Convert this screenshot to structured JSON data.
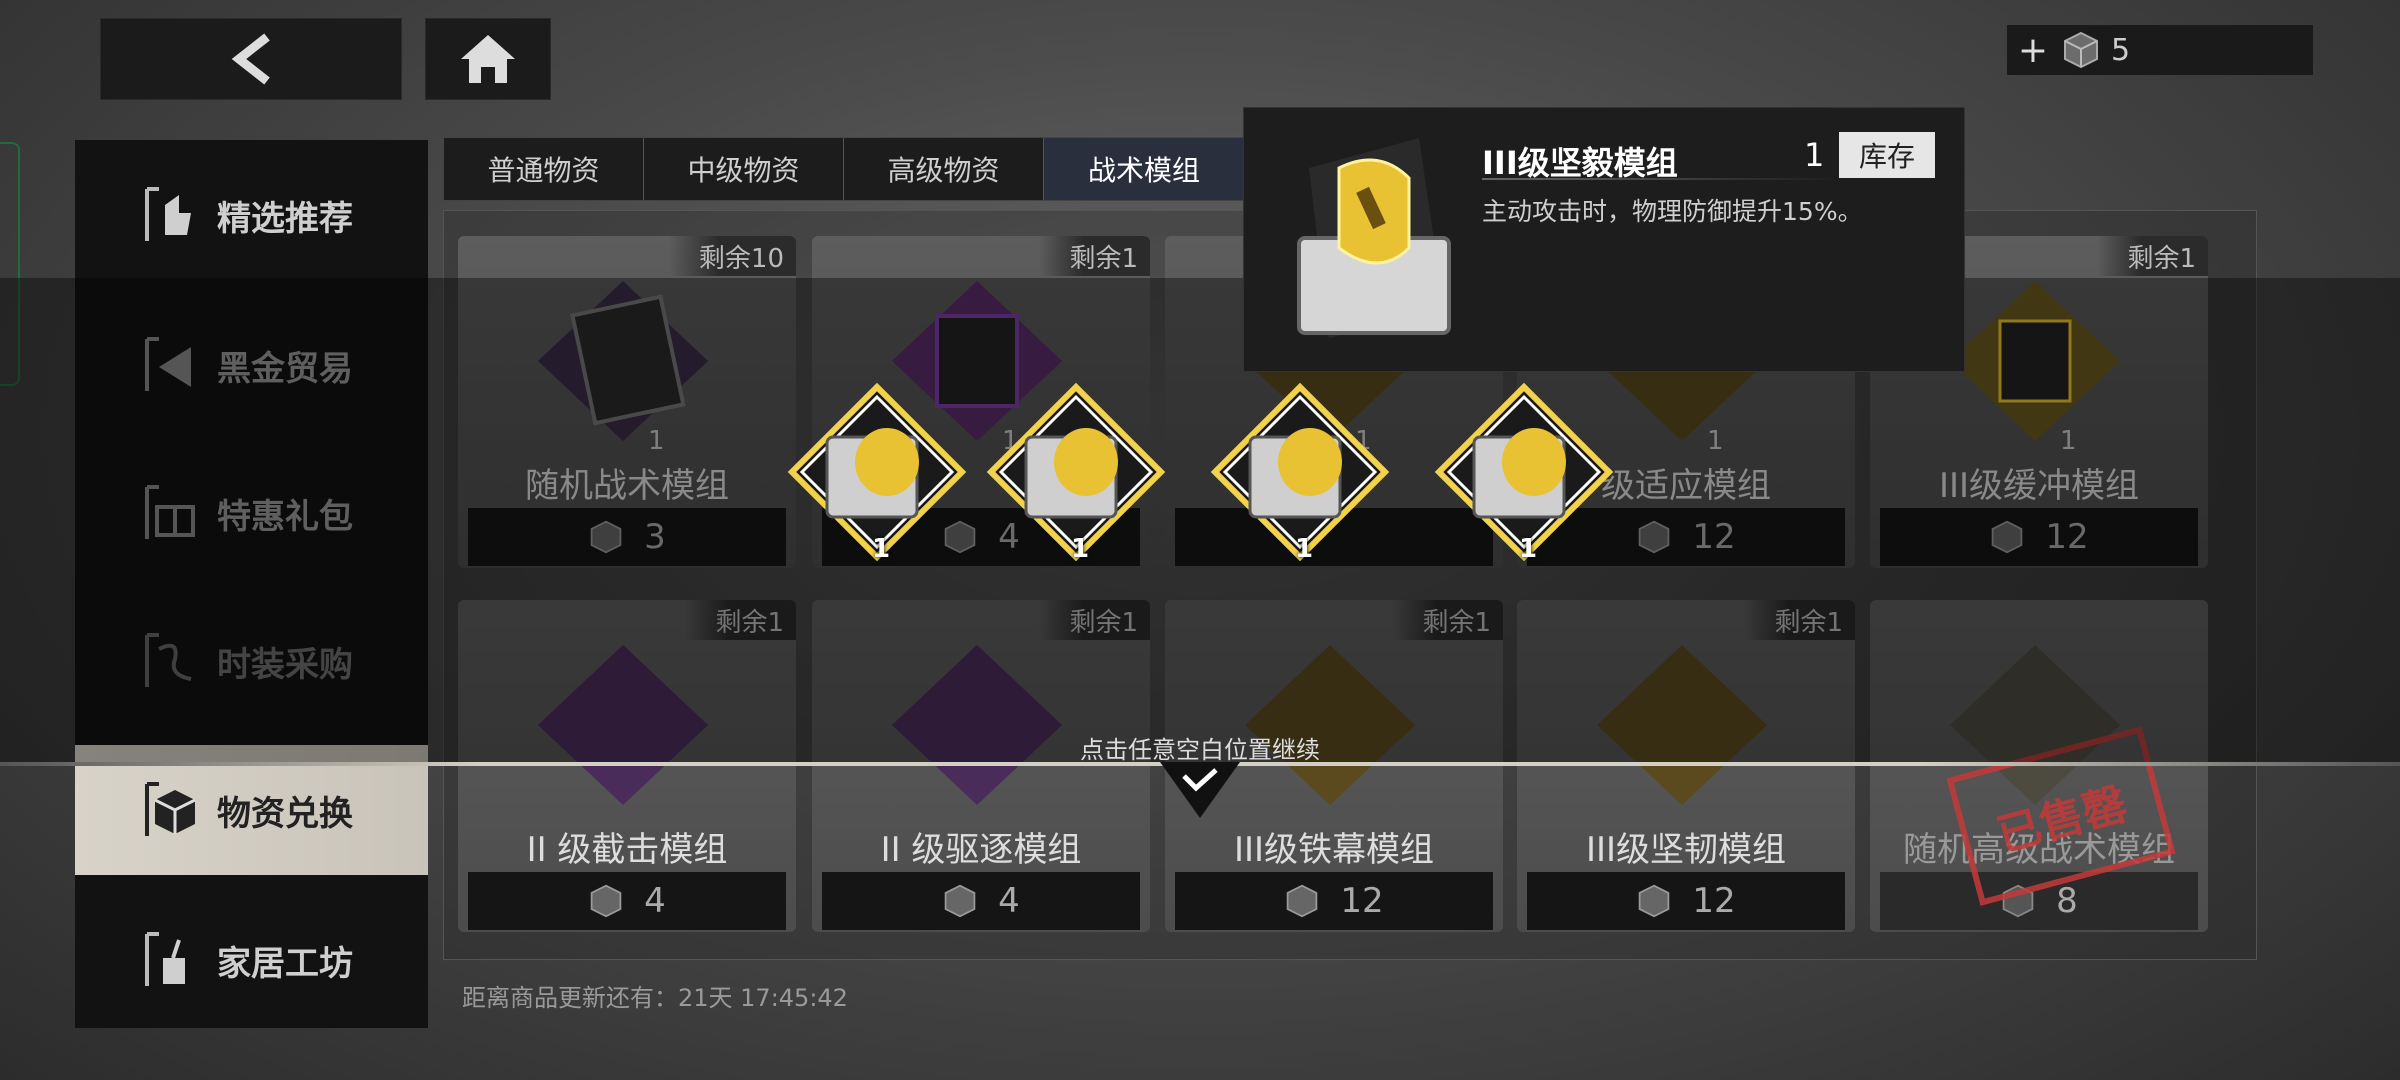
{
  "header": {
    "back_icon": "back-arrow-icon",
    "home_icon": "home-icon",
    "currency": {
      "icon": "cube-token-icon",
      "amount": "5"
    }
  },
  "sidebar": {
    "items": [
      {
        "label": "精选推荐",
        "icon": "recommend-icon"
      },
      {
        "label": "黑金贸易",
        "icon": "trade-icon"
      },
      {
        "label": "特惠礼包",
        "icon": "gift-icon"
      },
      {
        "label": "时装采购",
        "icon": "fashion-icon"
      },
      {
        "label": "物资兑换",
        "icon": "supply-box-icon"
      },
      {
        "label": "家居工坊",
        "icon": "workshop-icon"
      }
    ]
  },
  "tabs": [
    "普通物资",
    "中级物资",
    "高级物资",
    "战术模组"
  ],
  "cards": [
    {
      "remain": "剩余10",
      "name": "随机战术模组",
      "qty": "1",
      "price": "3"
    },
    {
      "remain": "剩余1",
      "name": "",
      "qty": "1",
      "price": "4"
    },
    {
      "remain": "",
      "name": "",
      "qty": "1",
      "price": ""
    },
    {
      "remain": "",
      "name": "级适应模组",
      "qty": "1",
      "price": "12"
    },
    {
      "remain": "剩余1",
      "name": "III级缓冲模组",
      "qty": "1",
      "price": "12"
    },
    {
      "remain": "剩余1",
      "name": "II 级截击模组",
      "qty": "",
      "price": "4"
    },
    {
      "remain": "剩余1",
      "name": "II 级驱逐模组",
      "qty": "",
      "price": "4"
    },
    {
      "remain": "剩余1",
      "name": "III级铁幕模组",
      "qty": "",
      "price": "12"
    },
    {
      "remain": "剩余1",
      "name": "III级坚韧模组",
      "qty": "",
      "price": "12"
    },
    {
      "remain": "",
      "name": "随机高级战术模组",
      "qty": "",
      "price": "8"
    }
  ],
  "sold_out_stamp": "已售罄",
  "refresh_text": "距离商品更新还有：21天 17:45:42",
  "rewards": [
    {
      "qty": "1"
    },
    {
      "qty": "1"
    },
    {
      "qty": "1"
    },
    {
      "qty": "1"
    }
  ],
  "tooltip": {
    "name": "III级坚毅模组",
    "count": "1",
    "stock_label": "库存",
    "desc": "主动攻击时，物理防御提升15%。"
  },
  "continue_text": "点击任意空白位置继续",
  "colors": {
    "accent_gold": "#e8c233",
    "accent_purple": "#7a3fa0",
    "tab_active": "#2a2f3e",
    "sold_red": "#c43a3a"
  }
}
